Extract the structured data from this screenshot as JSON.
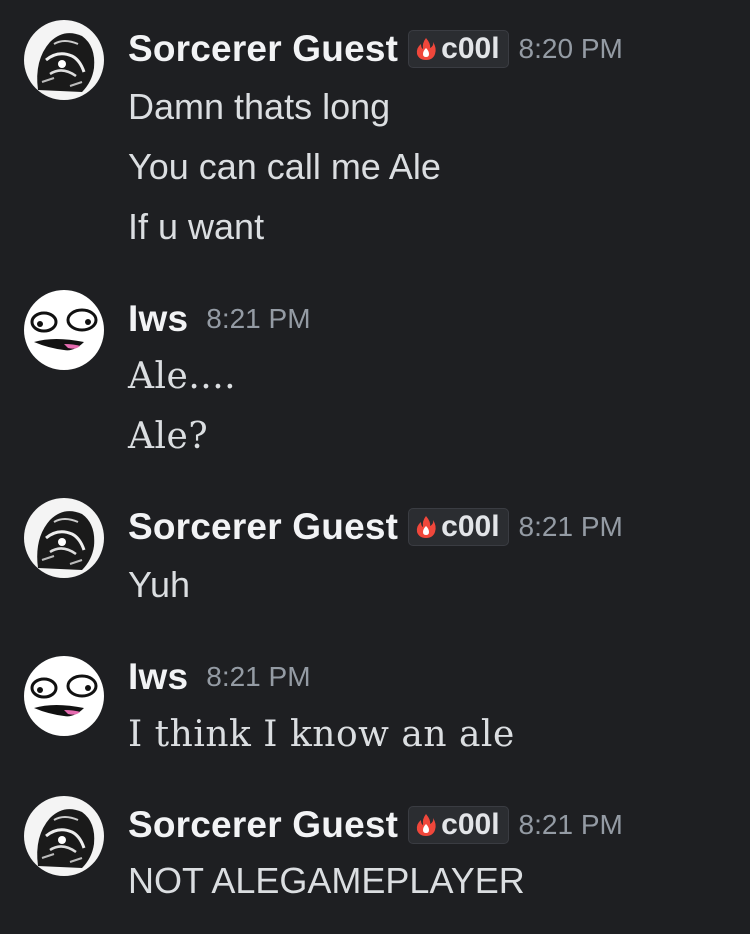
{
  "colors": {
    "background": "#1e1f22",
    "username": "#f2f3f5",
    "text": "#dbdee1",
    "timestamp": "#949ba4",
    "tag_bg": "#2b2d31",
    "tag_icon": "#f0473b"
  },
  "messages": [
    {
      "author": "Sorcerer Guest",
      "tag": "c00l",
      "tag_icon": "flame-icon",
      "time": "8:20 PM",
      "lines": [
        "Damn thats long",
        "You can call me Ale",
        "If u want"
      ]
    },
    {
      "author": "Iws",
      "time": "8:21 PM",
      "lines": [
        "Ale....",
        "Ale?"
      ]
    },
    {
      "author": "Sorcerer Guest",
      "tag": "c00l",
      "tag_icon": "flame-icon",
      "time": "8:21 PM",
      "lines": [
        "Yuh"
      ]
    },
    {
      "author": "Iws",
      "time": "8:21 PM",
      "lines": [
        "I think I know an ale"
      ]
    },
    {
      "author": "Sorcerer Guest",
      "tag": "c00l",
      "tag_icon": "flame-icon",
      "time": "8:21 PM",
      "lines": [
        "NOT ALEGAMEPLAYER"
      ]
    }
  ]
}
